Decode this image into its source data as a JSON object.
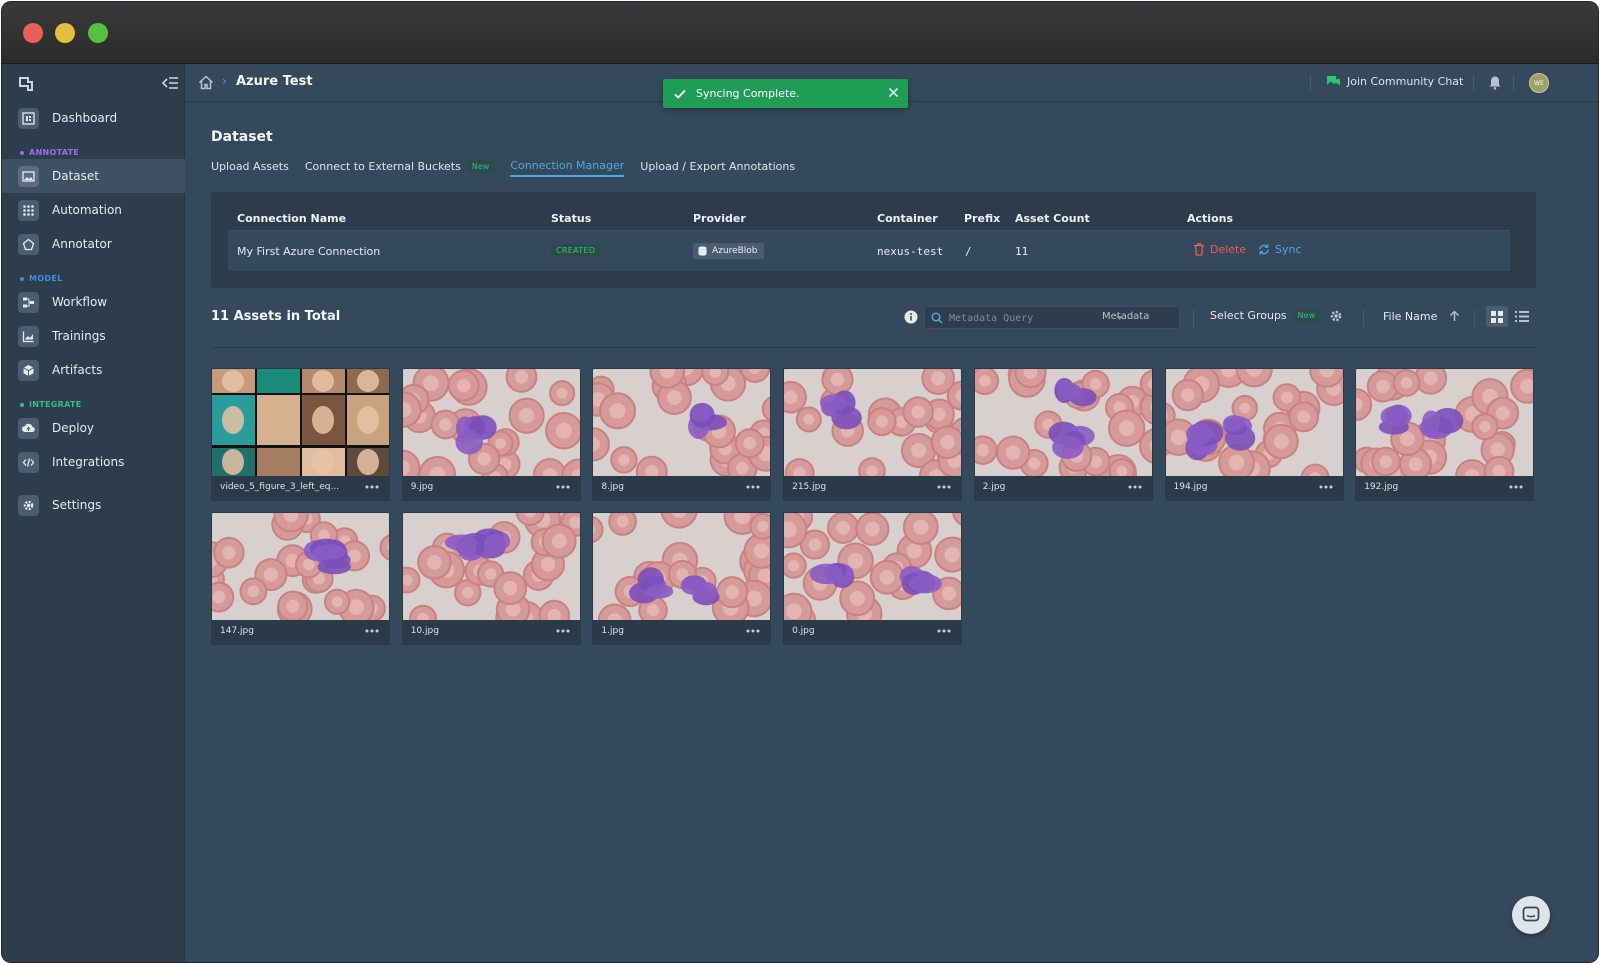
{
  "sidebar": {
    "sections": {
      "annotate": "ANNOTATE",
      "model": "MODEL",
      "integrate": "INTEGRATE"
    },
    "items": [
      {
        "label": "Dashboard"
      },
      {
        "label": "Dataset"
      },
      {
        "label": "Automation"
      },
      {
        "label": "Annotator"
      },
      {
        "label": "Workflow"
      },
      {
        "label": "Trainings"
      },
      {
        "label": "Artifacts"
      },
      {
        "label": "Deploy"
      },
      {
        "label": "Integrations"
      },
      {
        "label": "Settings"
      }
    ],
    "colors": {
      "annotate": "#9b6cf0",
      "model": "#3c8fe6",
      "integrate": "#2fc27c"
    }
  },
  "header": {
    "breadcrumb": "Azure Test",
    "toast": "Syncing Complete.",
    "community": "Join Community Chat",
    "avatar": "WE"
  },
  "main": {
    "title": "Dataset",
    "tabs": [
      {
        "label": "Upload Assets"
      },
      {
        "label": "Connect to External Buckets",
        "badge": "New"
      },
      {
        "label": "Connection Manager",
        "active": true
      },
      {
        "label": "Upload / Export Annotations"
      }
    ]
  },
  "connections": {
    "headers": {
      "name": "Connection Name",
      "status": "Status",
      "provider": "Provider",
      "container": "Container",
      "prefix": "Prefix",
      "count": "Asset Count",
      "actions": "Actions"
    },
    "rows": [
      {
        "name": "My First Azure Connection",
        "status": "CREATED",
        "provider": "AzureBlob",
        "container": "nexus-test",
        "prefix": "/",
        "count": "11",
        "delete": "Delete",
        "sync": "Sync"
      }
    ]
  },
  "assets": {
    "title": "11 Assets in Total",
    "search_placeholder": "Metadata Query",
    "search_scope": "Metadata",
    "select_groups": "Select Groups",
    "select_groups_badge": "New",
    "sort_by": "File Name",
    "items": [
      {
        "name": "video_5_figure_3_left_eq..."
      },
      {
        "name": "9.jpg"
      },
      {
        "name": "8.jpg"
      },
      {
        "name": "215.jpg"
      },
      {
        "name": "2.jpg"
      },
      {
        "name": "194.jpg"
      },
      {
        "name": "192.jpg"
      },
      {
        "name": "147.jpg"
      },
      {
        "name": "10.jpg"
      },
      {
        "name": "1.jpg"
      },
      {
        "name": "0.jpg"
      }
    ]
  }
}
